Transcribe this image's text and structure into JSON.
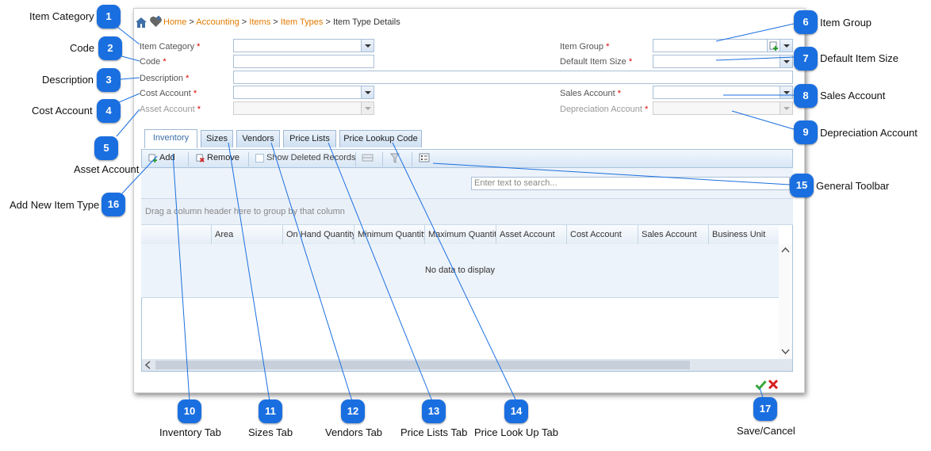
{
  "breadcrumb": {
    "home": "Home",
    "sep1": ">",
    "accounting": "Accounting",
    "sep2": ">",
    "items": "Items",
    "sep3": ">",
    "item_types": "Item Types",
    "sep4": ">",
    "current": "Item Type Details"
  },
  "form": {
    "item_category": "Item Category",
    "code": "Code",
    "description": "Description",
    "cost_account": "Cost Account",
    "asset_account": "Asset Account",
    "item_group": "Item Group",
    "default_item_size": "Default Item Size",
    "sales_account": "Sales Account",
    "depreciation_account": "Depreciation Account",
    "required_mark": "*"
  },
  "tabs": [
    "Inventory",
    "Sizes",
    "Vendors",
    "Price Lists",
    "Price Lookup Code"
  ],
  "toolbar": {
    "add": "Add",
    "remove": "Remove",
    "show_deleted": "Show Deleted Records"
  },
  "grid": {
    "search_placeholder": "Enter text to search...",
    "group_hint": "Drag a column header here to group by that column",
    "columns": [
      "",
      "Area",
      "On Hand Quantity",
      "Minimum Quantity",
      "Maximum Quantity",
      "Asset Account",
      "Cost Account",
      "Sales Account",
      "Business Unit"
    ],
    "empty_text": "No data to display"
  },
  "callouts": {
    "c1": {
      "num": "1",
      "label": "Item Category"
    },
    "c2": {
      "num": "2",
      "label": "Code"
    },
    "c3": {
      "num": "3",
      "label": "Description"
    },
    "c4": {
      "num": "4",
      "label": "Cost Account"
    },
    "c5": {
      "num": "5",
      "label": "Asset Account"
    },
    "c6": {
      "num": "6",
      "label": "Item Group"
    },
    "c7": {
      "num": "7",
      "label": "Default Item Size"
    },
    "c8": {
      "num": "8",
      "label": "Sales Account"
    },
    "c9": {
      "num": "9",
      "label": "Depreciation Account"
    },
    "c10": {
      "num": "10",
      "label": "Inventory Tab"
    },
    "c11": {
      "num": "11",
      "label": "Sizes Tab"
    },
    "c12": {
      "num": "12",
      "label": "Vendors Tab"
    },
    "c13": {
      "num": "13",
      "label": "Price Lists Tab"
    },
    "c14": {
      "num": "14",
      "label": "Price Look Up Tab"
    },
    "c15": {
      "num": "15",
      "label": "General Toolbar"
    },
    "c16": {
      "num": "16",
      "label": "Add New Item Type"
    },
    "c17": {
      "num": "17",
      "label": "Save/Cancel"
    }
  },
  "colors": {
    "callout": "#1a6fe0",
    "link": "#e07b00",
    "required": "#dd0000"
  }
}
